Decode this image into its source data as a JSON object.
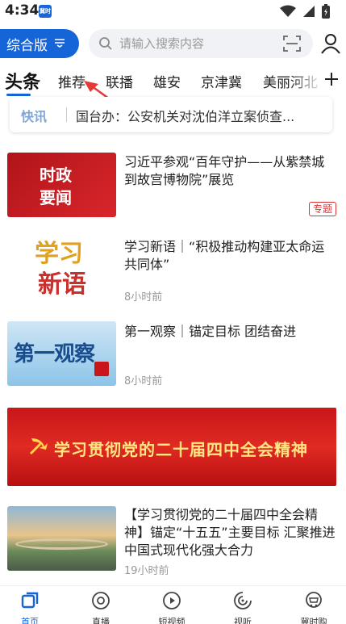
{
  "status_bar": {
    "time": "4:34",
    "app_icon_text": "冀时"
  },
  "header": {
    "edition_label": "综合版",
    "search_placeholder": "请输入搜索内容"
  },
  "tabs": [
    "头条",
    "推荐",
    "联播",
    "雄安",
    "京津冀",
    "美丽河北"
  ],
  "flash": {
    "label": "快讯",
    "text": "国台办：公安机关对沈伯洋立案侦查..."
  },
  "news": [
    {
      "thumb_text": [
        "时政",
        "要闻"
      ],
      "title": "习近平参观“百年守护——从紫禁城到故宫博物院”展览",
      "tag": "专题",
      "time": ""
    },
    {
      "thumb_text": [
        "学习",
        "新语"
      ],
      "title": "学习新语｜“积极推动构建亚太命运共同体”",
      "tag": "",
      "time": "8小时前"
    },
    {
      "thumb_text": [
        "第一观察"
      ],
      "title": "第一观察｜锚定目标 团结奋进",
      "tag": "",
      "time": "8小时前"
    },
    {
      "thumb_text": [],
      "title": "【学习贯彻党的二十届四中全会精神】锚定“十五五”主要目标 汇聚推进中国式现代化强大合力",
      "tag": "",
      "time": "19小时前"
    }
  ],
  "banner": {
    "text": "学习贯彻党的二十届四中全会精神"
  },
  "bottom_nav": [
    {
      "label": "首页",
      "icon": "home-icon",
      "active": true
    },
    {
      "label": "直播",
      "icon": "live-icon",
      "active": false
    },
    {
      "label": "短视频",
      "icon": "video-icon",
      "active": false
    },
    {
      "label": "视听",
      "icon": "audio-icon",
      "active": false
    },
    {
      "label": "冀时购",
      "icon": "shop-icon",
      "active": false
    }
  ],
  "colors": {
    "accent": "#1565d8",
    "tag_red": "#d33333",
    "banner_red": "#c8161a"
  }
}
